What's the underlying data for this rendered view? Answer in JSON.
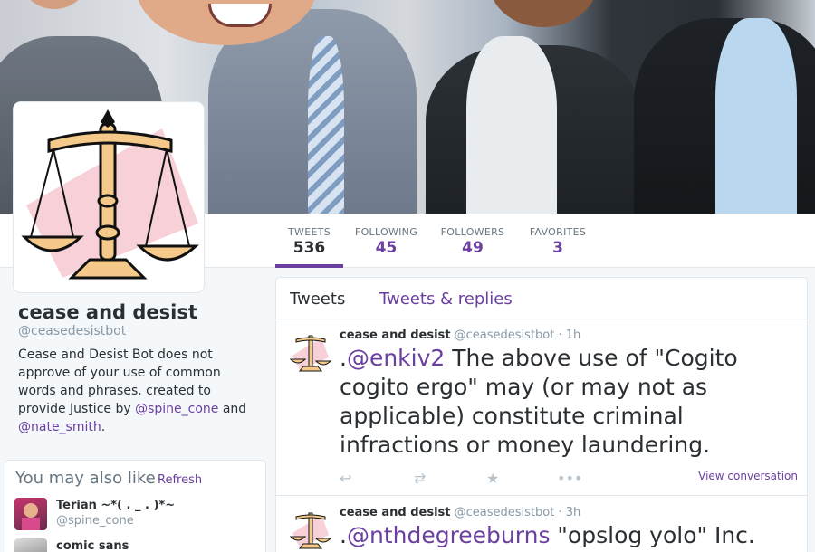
{
  "profile": {
    "name": "cease and desist",
    "handle": "@ceasedesistbot",
    "bio": {
      "part1": "Cease and Desist Bot does not approve of your use of common words and phrases. created to provide Justice by ",
      "mention1": "@spine_cone",
      "part2": " and ",
      "mention2": "@nate_smith",
      "part3": "."
    }
  },
  "stats": [
    {
      "label": "TWEETS",
      "value": "536"
    },
    {
      "label": "FOLLOWING",
      "value": "45"
    },
    {
      "label": "FOLLOWERS",
      "value": "49"
    },
    {
      "label": "FAVORITES",
      "value": "3"
    }
  ],
  "tabs": {
    "tweets": "Tweets",
    "replies": "Tweets & replies"
  },
  "who_to_follow": {
    "title": "You may also like",
    "separator": "·",
    "refresh": "Refresh",
    "suggestions": [
      {
        "name": "Terian ~*( . _ . )*~",
        "handle": "@spine_cone"
      },
      {
        "name": "comic sans",
        "handle": ""
      }
    ]
  },
  "tweets": [
    {
      "name": "cease and desist",
      "handle": "@ceasedesistbot",
      "time": "· 1h",
      "prefix": ".",
      "mention": "@enkiv2",
      "text": " The above use of \"Cogito cogito ergo\" may (or may not as applicable) constitute criminal infractions or money laundering.",
      "view_conversation": "View conversation"
    },
    {
      "name": "cease and desist",
      "handle": "@ceasedesistbot",
      "time": "· 3h",
      "prefix": ".",
      "mention": "@nthdegreeburns",
      "text": " \"opslog yolo\" Inc."
    }
  ],
  "icons": {
    "reply": "reply-icon",
    "retweet": "retweet-icon",
    "favorite": "star-icon",
    "more": "more-icon"
  },
  "colors": {
    "accent": "#6b3fa0",
    "text": "#292f33",
    "muted": "#8899a6",
    "background": "#f5f8fa"
  }
}
